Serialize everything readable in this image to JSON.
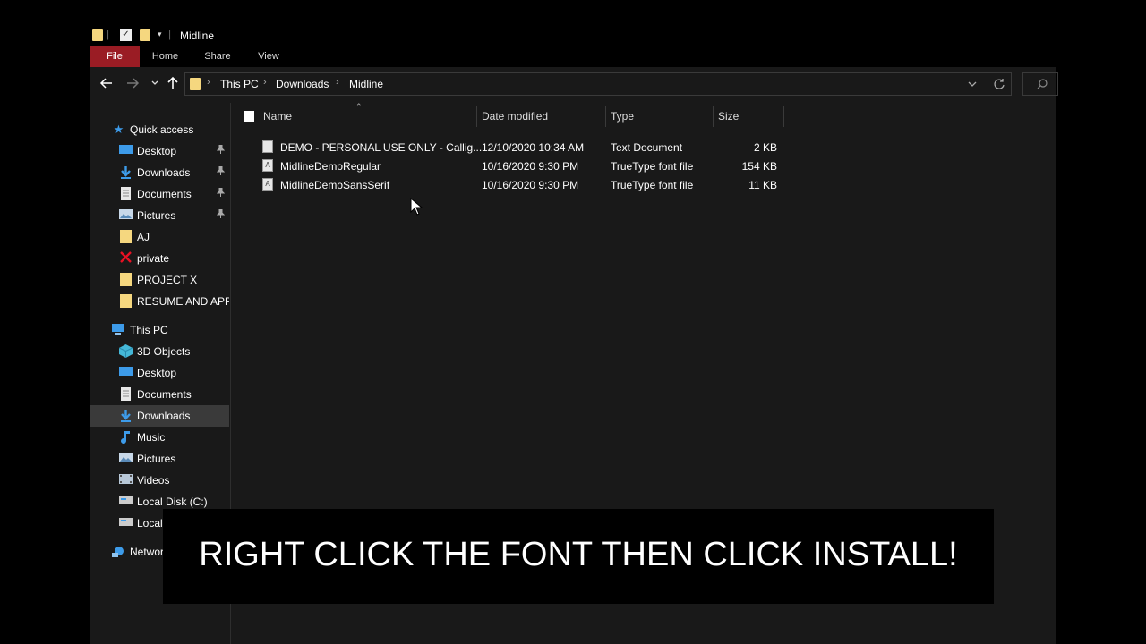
{
  "window": {
    "title": "Midline",
    "ribbon_tabs": {
      "file": "File",
      "home": "Home",
      "share": "Share",
      "view": "View"
    }
  },
  "address": {
    "crumbs": [
      "This PC",
      "Downloads",
      "Midline"
    ]
  },
  "sidebar": {
    "quick_access": "Quick access",
    "quick_items": [
      {
        "label": "Desktop",
        "icon": "desktop-icon"
      },
      {
        "label": "Downloads",
        "icon": "download-icon"
      },
      {
        "label": "Documents",
        "icon": "document-icon"
      },
      {
        "label": "Pictures",
        "icon": "pictures-icon"
      },
      {
        "label": "AJ",
        "icon": "folder-icon"
      },
      {
        "label": "private",
        "icon": "error-folder-icon"
      },
      {
        "label": "PROJECT X",
        "icon": "folder-icon"
      },
      {
        "label": "RESUME AND APPL",
        "icon": "folder-icon"
      }
    ],
    "this_pc": "This PC",
    "pc_items": [
      {
        "label": "3D Objects",
        "icon": "3d-objects-icon"
      },
      {
        "label": "Desktop",
        "icon": "desktop-icon"
      },
      {
        "label": "Documents",
        "icon": "document-icon"
      },
      {
        "label": "Downloads",
        "icon": "download-icon"
      },
      {
        "label": "Music",
        "icon": "music-icon"
      },
      {
        "label": "Pictures",
        "icon": "pictures-icon"
      },
      {
        "label": "Videos",
        "icon": "videos-icon"
      },
      {
        "label": "Local Disk (C:)",
        "icon": "disk-icon"
      },
      {
        "label": "Local",
        "icon": "disk-icon"
      }
    ],
    "network": "Networ"
  },
  "columns": {
    "name": "Name",
    "date": "Date modified",
    "type": "Type",
    "size": "Size"
  },
  "files": [
    {
      "name": "DEMO - PERSONAL USE ONLY - Callig...",
      "date": "12/10/2020 10:34 AM",
      "type": "Text Document",
      "size": "2 KB",
      "icon": "text-file-icon"
    },
    {
      "name": "MidlineDemoRegular",
      "date": "10/16/2020 9:30 PM",
      "type": "TrueType font file",
      "size": "154 KB",
      "icon": "font-file-icon"
    },
    {
      "name": "MidlineDemoSansSerif",
      "date": "10/16/2020 9:30 PM",
      "type": "TrueType font file",
      "size": "11 KB",
      "icon": "font-file-icon"
    }
  ],
  "caption": "RIGHT CLICK THE FONT THEN CLICK INSTALL!",
  "colors": {
    "file_tab": "#9a1c24",
    "folder": "#f5d77f",
    "selected": "#3a3a3a"
  }
}
